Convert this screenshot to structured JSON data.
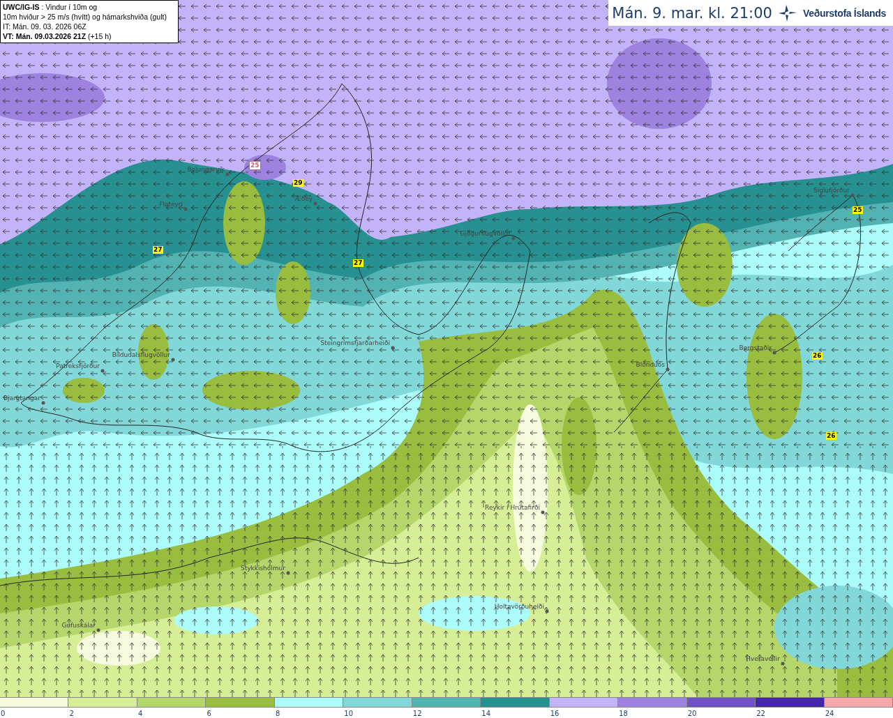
{
  "info_box": {
    "lines": [
      "**UWC/IG-IS** : Vindur í 10m og",
      "10m hviður > 25 m/s (hvítt) og hámarkshviða (gult)",
      "IT: Mán. 09. 03. 2026 06Z",
      "**VT: Mán. 09.03.2026 21Z** (+15 h)"
    ]
  },
  "valid_time": "Mán. 9. mar. kl. 21:00",
  "logo": {
    "text": "Veðurstofa Íslands"
  },
  "map": {
    "stations": [
      {
        "name": "Bolungarvík"
      },
      {
        "name": "Flateyri"
      },
      {
        "name": "Æðey"
      },
      {
        "name": "Gjögurflugvöllur"
      },
      {
        "name": "Steingrímsfjarðarheiði"
      },
      {
        "name": "Bíldudalsflugvöllur"
      },
      {
        "name": "Patreksfjörður"
      },
      {
        "name": "Bjargtangar"
      },
      {
        "name": "Blönduós"
      },
      {
        "name": "Bergstaðir"
      },
      {
        "name": "Siglufjörður"
      },
      {
        "name": "Reykir í Hrútafirði"
      },
      {
        "name": "Stykkishólmur"
      },
      {
        "name": "Holtavörðuheiði"
      },
      {
        "name": "Gufuskálar"
      },
      {
        "name": "Hveravellir"
      }
    ],
    "gust_markers": [
      {
        "value": "25",
        "kind": "gust"
      },
      {
        "value": "29",
        "kind": "max"
      },
      {
        "value": "27",
        "kind": "max"
      },
      {
        "value": "27",
        "kind": "max"
      },
      {
        "value": "25",
        "kind": "max"
      },
      {
        "value": "26",
        "kind": "max"
      },
      {
        "value": "26",
        "kind": "max"
      }
    ]
  },
  "legend": {
    "bins": [
      {
        "color": "#f5fbdc"
      },
      {
        "color": "#d6ee96"
      },
      {
        "color": "#b5d66a"
      },
      {
        "color": "#98bd3f"
      },
      {
        "color": "#adfcfc"
      },
      {
        "color": "#82d8d8"
      },
      {
        "color": "#53b3b3"
      },
      {
        "color": "#279090"
      },
      {
        "color": "#c3b3f8"
      },
      {
        "color": "#9d82e0"
      },
      {
        "color": "#7152c4"
      },
      {
        "color": "#4426a8"
      },
      {
        "color": "#f8a8a8"
      }
    ],
    "ticks": [
      "0",
      "2",
      "4",
      "6",
      "8",
      "10",
      "12",
      "14",
      "16",
      "18",
      "20",
      "22",
      "24"
    ]
  }
}
